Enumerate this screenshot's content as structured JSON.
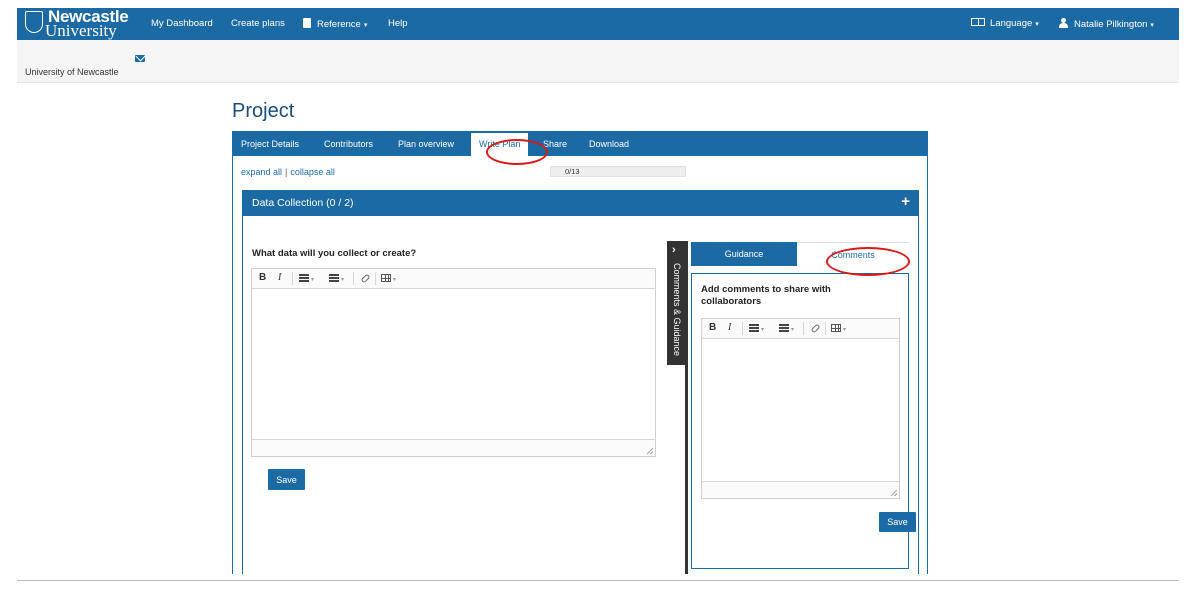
{
  "navbar": {
    "logo": {
      "line1": "Newcastle",
      "line2": "University"
    },
    "items": [
      {
        "label": "My Dashboard"
      },
      {
        "label": "Create plans"
      },
      {
        "label": "Reference",
        "caret": "▾"
      },
      {
        "label": "Help"
      }
    ],
    "language": {
      "label": "Language",
      "caret": "▾"
    },
    "user": {
      "label": "Natalie Pilkington",
      "caret": "▾"
    }
  },
  "org": {
    "name": "University of Newcastle"
  },
  "page": {
    "title": "Project"
  },
  "tabs": [
    {
      "label": "Project Details"
    },
    {
      "label": "Contributors"
    },
    {
      "label": "Plan overview"
    },
    {
      "label": "Write Plan",
      "active": true
    },
    {
      "label": "Share"
    },
    {
      "label": "Download"
    }
  ],
  "controls": {
    "expand": "expand all",
    "separator": "|",
    "collapse": "collapse all"
  },
  "progress": {
    "text": "0/13",
    "answered": 0,
    "total": 13
  },
  "section": {
    "title": "Data Collection (0 / 2)",
    "toggle": "+"
  },
  "question": {
    "text": "What data will you collect or create?",
    "answer": "",
    "save_label": "Save"
  },
  "editor_toolbar": {
    "bold": "B",
    "italic": "I",
    "caret": "▾"
  },
  "side_tab": {
    "label": "Comments & Guidance",
    "chevron": "›"
  },
  "panel": {
    "tabs": [
      {
        "label": "Guidance"
      },
      {
        "label": "Comments",
        "active": true
      }
    ],
    "heading": "Add comments to share with collaborators",
    "comment": "",
    "save_label": "Save"
  },
  "colors": {
    "primary": "#1c6aa3",
    "highlight": "#d71a1a",
    "side_tab": "#333333"
  }
}
